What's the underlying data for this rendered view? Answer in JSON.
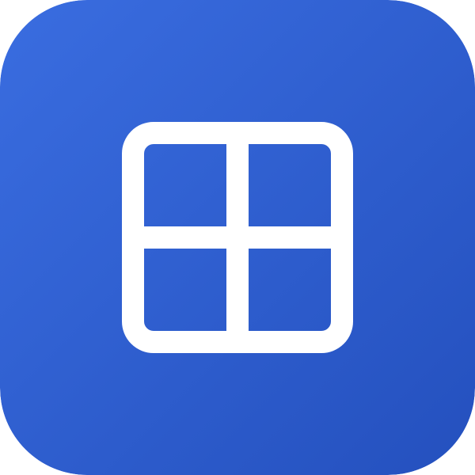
{
  "app_icon": {
    "icon": "grid-four-squares-icon",
    "colors": {
      "gradient_start": "#3A6DE0",
      "gradient_end": "#2450BE",
      "glyph": "#FFFFFF"
    }
  }
}
